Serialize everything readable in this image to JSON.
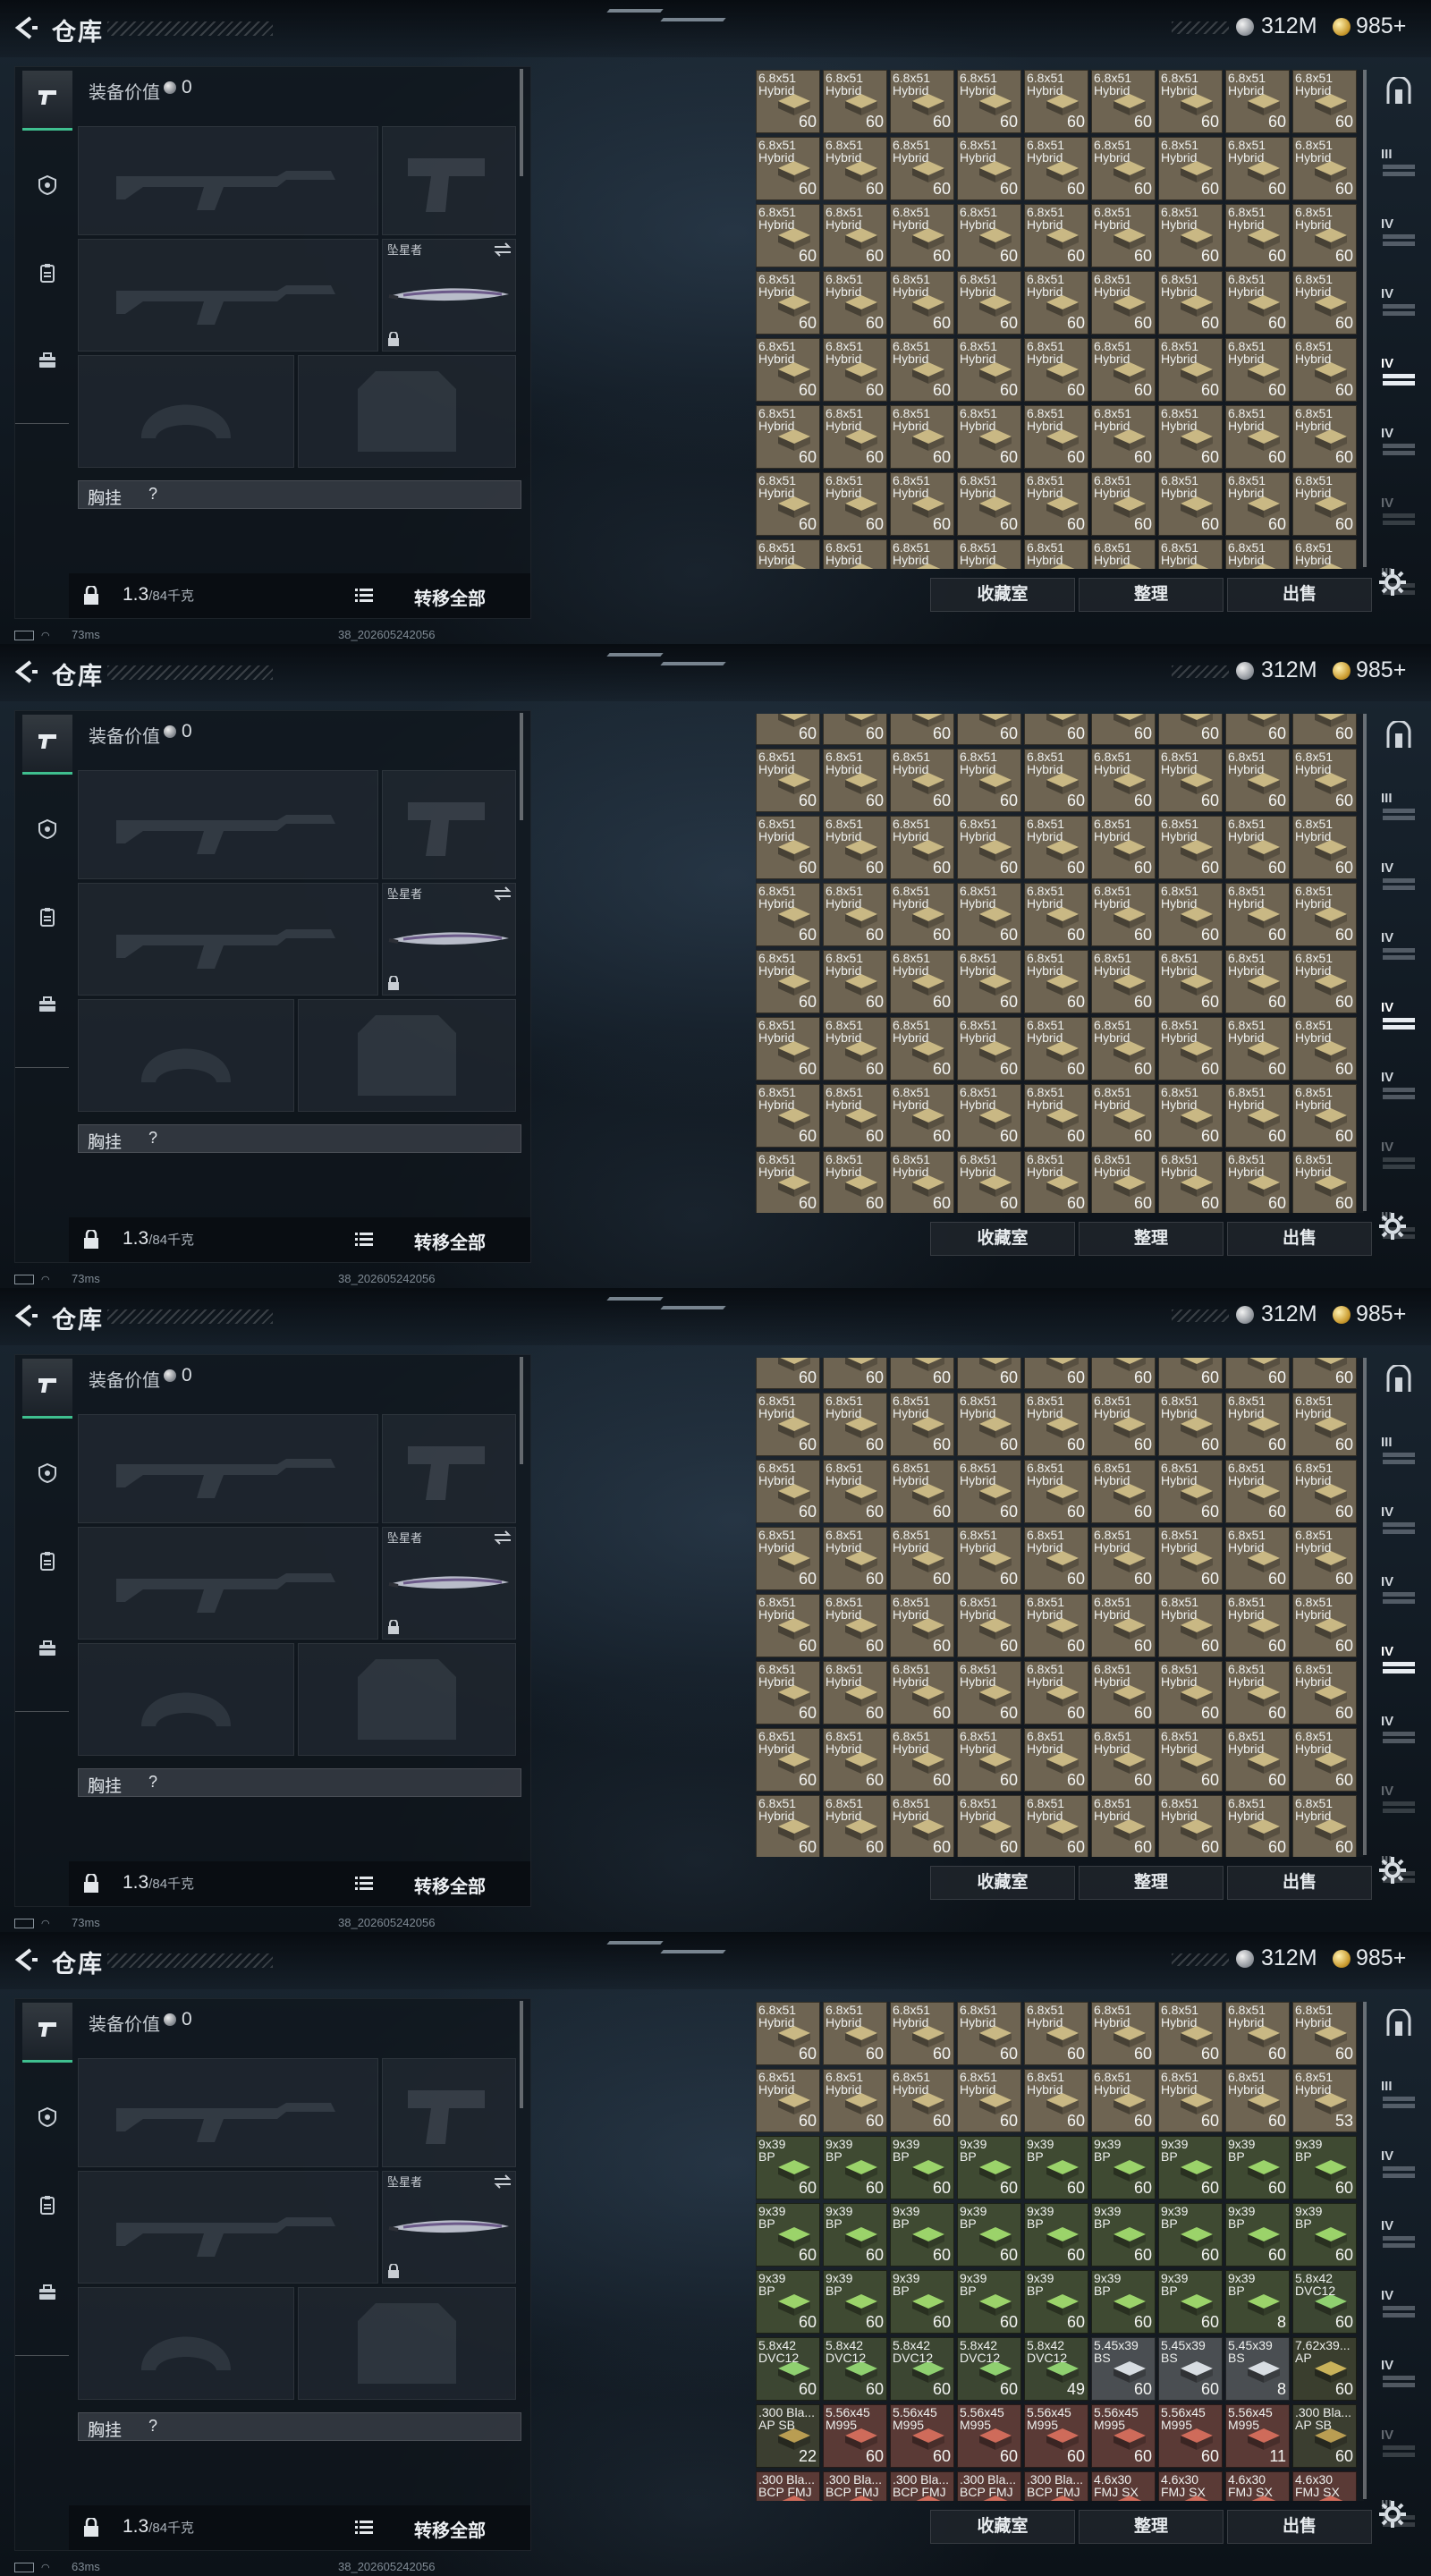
{
  "screens": [
    {
      "ping": "73ms",
      "view": "top"
    },
    {
      "ping": "73ms",
      "view": "mid"
    },
    {
      "ping": "73ms",
      "view": "mid2"
    },
    {
      "ping": "63ms",
      "view": "bottom"
    }
  ],
  "header": {
    "title": "仓库",
    "silver": "312M",
    "gold": "985+"
  },
  "loadout": {
    "equip_value_label": "装备价值",
    "equip_value": "0",
    "knife_name": "坠星者",
    "chest_label": "胸挂",
    "chest_help": "?",
    "weight": "1.3",
    "weight_max": "/84千克",
    "transfer_all": "转移全部"
  },
  "side_tabs": [
    "weapon-tab-icon",
    "armor-tab-icon",
    "medical-tab-icon",
    "briefcase-tab-icon"
  ],
  "actions": {
    "collection": "收藏室",
    "sort": "整理",
    "sell": "出售"
  },
  "status": {
    "build": "38_202605242056"
  },
  "rail": [
    "display-case-icon",
    "III",
    "IV",
    "IV",
    "IV",
    "IV",
    "IV",
    "III"
  ],
  "items": {
    "ammo_68": {
      "name": "6.8x51\nHybrid",
      "count": "60",
      "color": "#6e6452",
      "box": "#c9b884"
    },
    "ammo_939": {
      "name": "9x39\nBP",
      "color": "#3f4a32",
      "box": "#9bd36a"
    },
    "ammo_58": {
      "name": "5.8x42\nDVC12",
      "color": "#3c4632",
      "box": "#8fd070"
    },
    "ammo_762": {
      "name": "7.62x39...\nAP",
      "color": "#3a3e2e",
      "box": "#c9b25a"
    },
    "ammo_545": {
      "name": "5.45x39\nBS",
      "color": "#4a4e52",
      "box": "#d8dde2"
    },
    "ammo_300": {
      "name": ".300 Bla...\nAP SB",
      "color": "#3b3e30",
      "box": "#b99d52"
    },
    "ammo_556": {
      "name": "5.56x45\nM995",
      "color": "#5a3a36",
      "box": "#cf6b5a"
    },
    "ammo_300b": {
      "name": ".300 Bla...\nBCP FMJ",
      "color": "#5a3a36",
      "box": "#cf6b5a"
    },
    "ammo_46": {
      "name": "4.6x30\nFMJ SX",
      "color": "#5a3a36",
      "box": "#cf6b5a"
    }
  },
  "bottom_grid": [
    [
      [
        "ammo_68",
        "60"
      ],
      [
        "ammo_68",
        "60"
      ],
      [
        "ammo_68",
        "60"
      ],
      [
        "ammo_68",
        "60"
      ],
      [
        "ammo_68",
        "60"
      ],
      [
        "ammo_68",
        "60"
      ],
      [
        "ammo_68",
        "60"
      ],
      [
        "ammo_68",
        "60"
      ],
      [
        "ammo_68",
        "60"
      ]
    ],
    [
      [
        "ammo_68",
        "60"
      ],
      [
        "ammo_68",
        "60"
      ],
      [
        "ammo_68",
        "60"
      ],
      [
        "ammo_68",
        "60"
      ],
      [
        "ammo_68",
        "60"
      ],
      [
        "ammo_68",
        "60"
      ],
      [
        "ammo_68",
        "60"
      ],
      [
        "ammo_68",
        "60"
      ],
      [
        "ammo_68",
        "53"
      ]
    ],
    [
      [
        "ammo_939",
        "60"
      ],
      [
        "ammo_939",
        "60"
      ],
      [
        "ammo_939",
        "60"
      ],
      [
        "ammo_939",
        "60"
      ],
      [
        "ammo_939",
        "60"
      ],
      [
        "ammo_939",
        "60"
      ],
      [
        "ammo_939",
        "60"
      ],
      [
        "ammo_939",
        "60"
      ],
      [
        "ammo_939",
        "60"
      ]
    ],
    [
      [
        "ammo_939",
        "60"
      ],
      [
        "ammo_939",
        "60"
      ],
      [
        "ammo_939",
        "60"
      ],
      [
        "ammo_939",
        "60"
      ],
      [
        "ammo_939",
        "60"
      ],
      [
        "ammo_939",
        "60"
      ],
      [
        "ammo_939",
        "60"
      ],
      [
        "ammo_939",
        "60"
      ],
      [
        "ammo_939",
        "60"
      ]
    ],
    [
      [
        "ammo_939",
        "60"
      ],
      [
        "ammo_939",
        "60"
      ],
      [
        "ammo_939",
        "60"
      ],
      [
        "ammo_939",
        "60"
      ],
      [
        "ammo_939",
        "60"
      ],
      [
        "ammo_939",
        "60"
      ],
      [
        "ammo_939",
        "60"
      ],
      [
        "ammo_939",
        "8"
      ],
      [
        "ammo_58",
        "60"
      ]
    ],
    [
      [
        "ammo_58",
        "60"
      ],
      [
        "ammo_58",
        "60"
      ],
      [
        "ammo_58",
        "60"
      ],
      [
        "ammo_58",
        "60"
      ],
      [
        "ammo_58",
        "49"
      ],
      [
        "ammo_545",
        "60"
      ],
      [
        "ammo_545",
        "60"
      ],
      [
        "ammo_545",
        "8"
      ],
      [
        "ammo_762",
        "60"
      ]
    ],
    [
      [
        "ammo_300",
        "22"
      ],
      [
        "ammo_556",
        "60"
      ],
      [
        "ammo_556",
        "60"
      ],
      [
        "ammo_556",
        "60"
      ],
      [
        "ammo_556",
        "60"
      ],
      [
        "ammo_556",
        "60"
      ],
      [
        "ammo_556",
        "60"
      ],
      [
        "ammo_556",
        "11"
      ],
      [
        "ammo_300",
        "60"
      ]
    ],
    [
      [
        "ammo_300b",
        ""
      ],
      [
        "ammo_300b",
        ""
      ],
      [
        "ammo_300b",
        ""
      ],
      [
        "ammo_300b",
        ""
      ],
      [
        "ammo_300b",
        ""
      ],
      [
        "ammo_46",
        ""
      ],
      [
        "ammo_46",
        ""
      ],
      [
        "ammo_46",
        ""
      ],
      [
        "ammo_46",
        ""
      ]
    ]
  ]
}
